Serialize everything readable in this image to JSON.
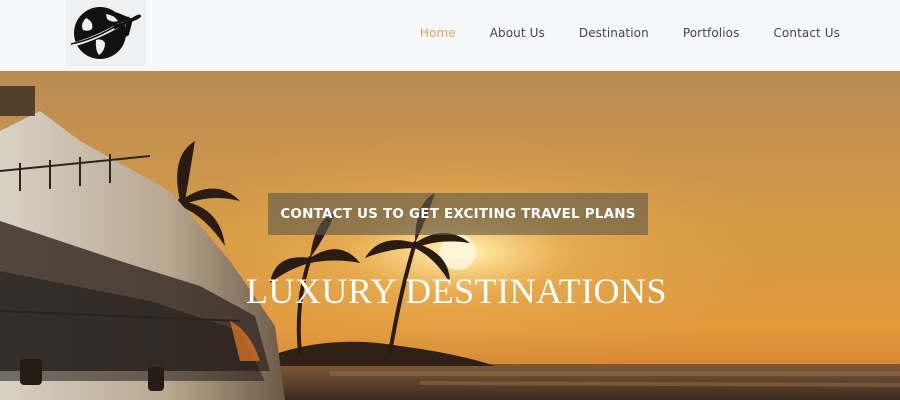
{
  "nav": {
    "items": [
      {
        "label": "Home",
        "active": true
      },
      {
        "label": "About Us",
        "active": false
      },
      {
        "label": "Destination",
        "active": false
      },
      {
        "label": "Portfolios",
        "active": false
      },
      {
        "label": "Contact Us",
        "active": false
      }
    ]
  },
  "hero": {
    "cta_label": "CONTACT US TO GET EXCITING TRAVEL PLANS",
    "title": "LUXURY DESTINATIONS"
  },
  "colors": {
    "nav_active": "#e0a75e",
    "nav_text": "#454545",
    "nav_background": "#f7f8fa"
  },
  "icons": {
    "logo": "globe-airplane-icon"
  }
}
